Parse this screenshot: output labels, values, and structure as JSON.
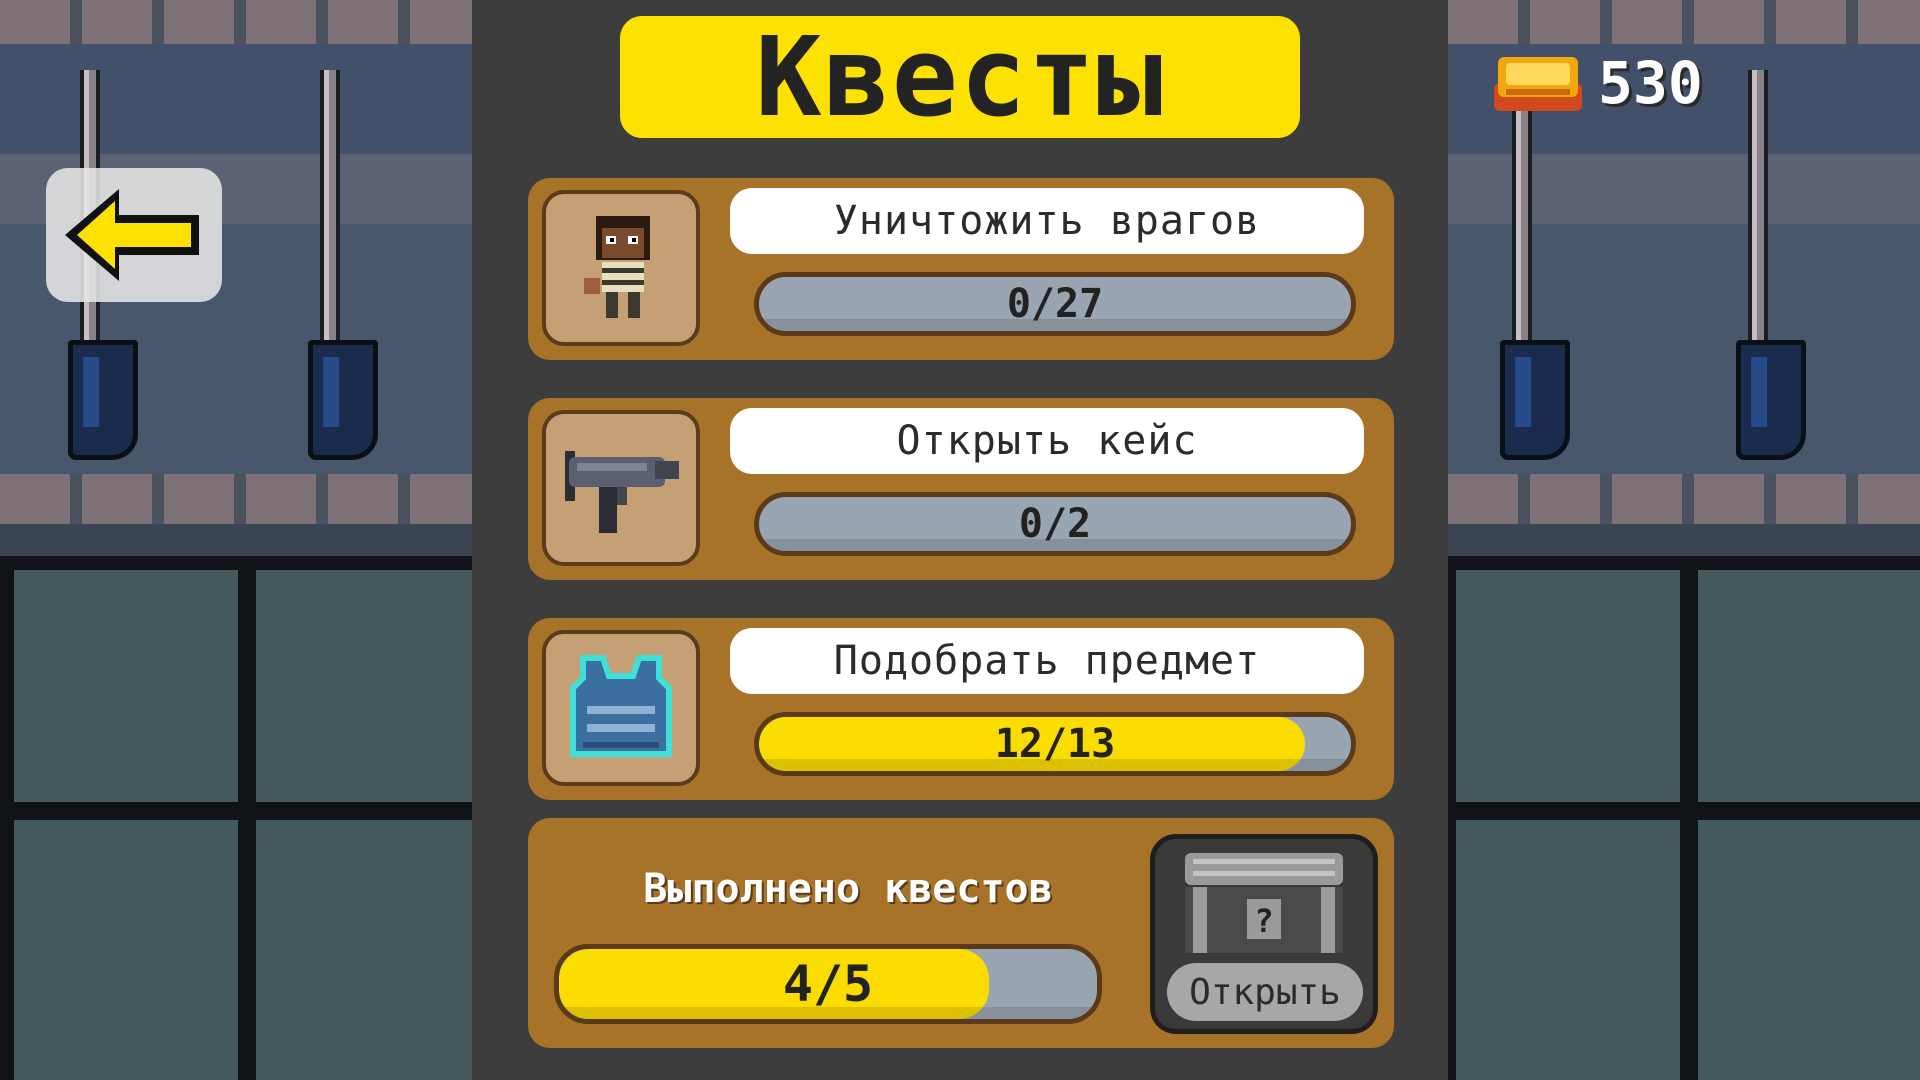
{
  "title": "Квесты",
  "currency": {
    "value": "530",
    "icon": "gold-bar-icon"
  },
  "quests": [
    {
      "label": "Уничтожить врагов",
      "progress_text": "0/27",
      "progress": 0.0,
      "icon": "enemy-character-icon"
    },
    {
      "label": "Открыть кейс",
      "progress_text": "0/2",
      "progress": 0.0,
      "icon": "uzi-gun-icon"
    },
    {
      "label": "Подобрать предмет",
      "progress_text": "12/13",
      "progress": 0.923,
      "icon": "armor-vest-icon"
    }
  ],
  "summary": {
    "label": "Выполнено квестов",
    "progress_text": "4/5",
    "progress": 0.8,
    "open_label": "Открыть",
    "chest_icon": "mystery-chest-icon"
  },
  "colors": {
    "accent": "#fde102",
    "card": "#a77329",
    "bar_fill": "#fbdc00",
    "bar_empty": "#9aa5b2"
  }
}
